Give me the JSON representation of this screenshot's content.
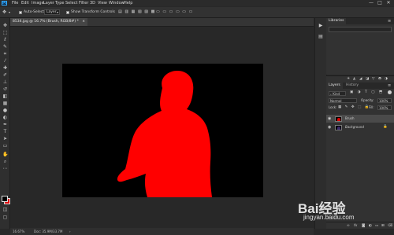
{
  "app": {
    "logo": "Ps"
  },
  "menubar": {
    "items": [
      "File",
      "Edit",
      "Image",
      "Layer",
      "Type",
      "Select",
      "Filter",
      "3D",
      "View",
      "Window",
      "Help"
    ],
    "window_controls": [
      "—",
      "□",
      "✕"
    ]
  },
  "options_bar": {
    "auto_select_label": "Auto-Select:",
    "auto_select_value": "Layer",
    "show_transform_label": "Show Transform Controls"
  },
  "document": {
    "tab_label": "8534.jpg @ 16.7% (Brush, RGB/8#) *",
    "close_label": "×",
    "zoom": "16.67%",
    "doc_info": "Doc: 35.9M/33.7M"
  },
  "colors": {
    "foreground": "#000000",
    "background": "#e00000",
    "figure": "#ff0000",
    "canvas": "#000000"
  },
  "panels": {
    "top_tab": "Libraries",
    "libraries_placeholder": "",
    "layers_tab": "Layers",
    "history_tab": "History",
    "filter_kind": "Kind",
    "blend_mode": "Normal",
    "opacity_label": "Opacity:",
    "opacity_value": "100%",
    "lock_label": "Lock:",
    "fill_label": "Fill:",
    "fill_value": "100%",
    "layers": [
      {
        "name": "Brush",
        "selected": true,
        "locked": false
      },
      {
        "name": "Background",
        "selected": false,
        "locked": true
      }
    ]
  },
  "watermark": {
    "brand": "Bai经验",
    "url": "jingyan.baidu.com"
  }
}
